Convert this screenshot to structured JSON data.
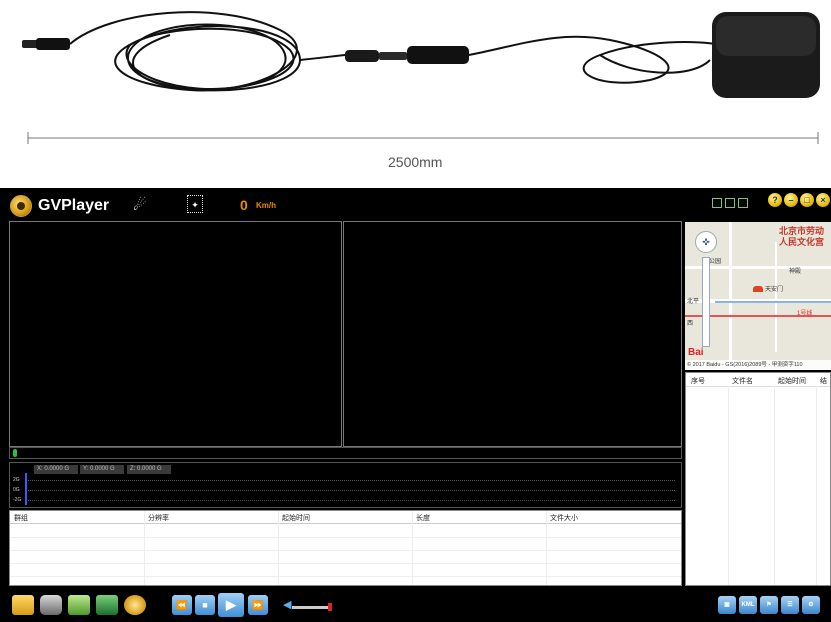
{
  "product": {
    "dimension_label": "2500mm"
  },
  "app": {
    "title": "GVPlayer",
    "satellite_icon": "satellite-icon",
    "gps_icon": "gps-icon",
    "speed_value": "0",
    "speed_unit": "Km/h",
    "window_buttons": [
      "help-icon",
      "minimize-icon",
      "maximize-icon",
      "close-icon"
    ]
  },
  "gsensor": {
    "x_label": "X: 0.0000 G",
    "y_label": "Y: 0.0000 G",
    "z_label": "Z: 0.0000 G",
    "ticks": [
      "2G",
      "0G",
      "-2G"
    ],
    "colors": {
      "cursor": "#3a5cff"
    }
  },
  "segment_table": {
    "headers": [
      "群组",
      "分辨率",
      "起始时间",
      "长度",
      "文件大小"
    ],
    "rows": []
  },
  "map": {
    "place_line1": "北京市劳动",
    "place_line2": "人民文化宫",
    "label_park": "公园",
    "label_temple": "神殿",
    "label_chang": "北平",
    "label_west": "西",
    "label_line": "1号线",
    "label_gate": "天安门",
    "logo": "Bai",
    "copyright": "© 2017 Baidu - GS(2016)2089号 - 甲测资字110"
  },
  "file_list": {
    "headers": [
      "序号",
      "文件名",
      "起始时间",
      "结"
    ],
    "rows": []
  },
  "toolbar": {
    "left_icons": [
      "open-folder-icon",
      "snapshot-camera-icon",
      "export-icon",
      "clip-icon",
      "disk-icon"
    ],
    "playback": [
      "rewind-icon",
      "stop-icon",
      "play-icon",
      "fast-forward-icon"
    ],
    "right_icons": [
      "screen-icon",
      "kml-icon",
      "map-icon",
      "list-icon",
      "settings-icon"
    ],
    "kml_label": "KML",
    "volume": 1.0
  }
}
